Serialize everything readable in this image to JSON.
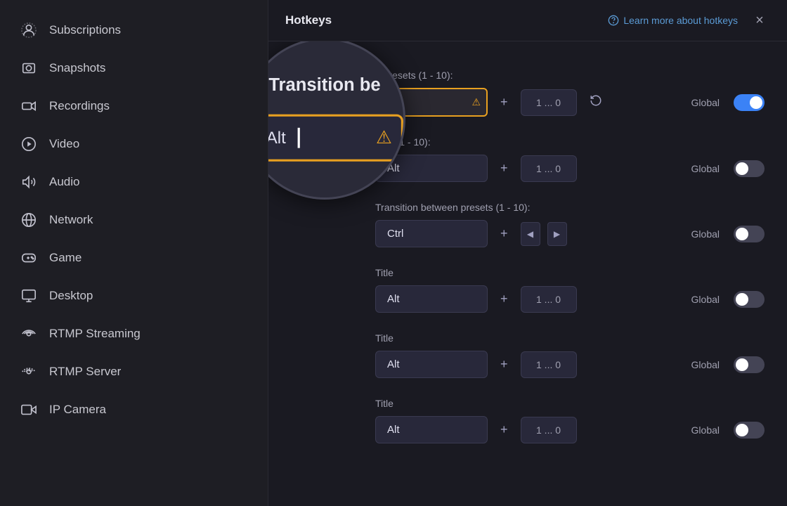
{
  "sidebar": {
    "items": [
      {
        "id": "subscriptions",
        "label": "Subscriptions",
        "icon": "person-circle"
      },
      {
        "id": "snapshots",
        "label": "Snapshots",
        "icon": "image"
      },
      {
        "id": "recordings",
        "label": "Recordings",
        "icon": "video-camera"
      },
      {
        "id": "video",
        "label": "Video",
        "icon": "play-circle"
      },
      {
        "id": "audio",
        "label": "Audio",
        "icon": "speaker"
      },
      {
        "id": "network",
        "label": "Network",
        "icon": "globe"
      },
      {
        "id": "game",
        "label": "Game",
        "icon": "gamepad"
      },
      {
        "id": "desktop",
        "label": "Desktop",
        "icon": "monitor"
      },
      {
        "id": "rtmp-streaming",
        "label": "RTMP Streaming",
        "icon": "broadcast"
      },
      {
        "id": "rtmp-server",
        "label": "RTMP Server",
        "icon": "server"
      },
      {
        "id": "ip-camera",
        "label": "IP Camera",
        "icon": "camera"
      }
    ]
  },
  "header": {
    "title": "Hotkeys",
    "learn_link": "Learn more about hotkeys",
    "close_label": "×"
  },
  "zoom": {
    "title": "Transition be",
    "input_value": "Alt"
  },
  "hotkeys": [
    {
      "label": "n presets (1 - 10):",
      "key": "Alt",
      "key_display": "1 ... 0",
      "global": true,
      "has_warning": true
    },
    {
      "label": "sets (1 - 10):",
      "key": "Alt",
      "key_display": "1 ... 0",
      "global": false,
      "has_warning": false
    },
    {
      "label": "Transition between presets (1 - 10):",
      "key": "Ctrl",
      "key_display": "",
      "has_arrows": true,
      "global": false,
      "has_warning": false
    },
    {
      "label": "Title",
      "key": "Alt",
      "key_display": "1 ... 0",
      "global": false,
      "has_warning": false
    },
    {
      "label": "Title",
      "key": "Alt",
      "key_display": "1 ... 0",
      "global": false,
      "has_warning": false
    },
    {
      "label": "Title",
      "key": "Alt",
      "key_display": "1 ... 0",
      "global": false,
      "has_warning": false
    }
  ]
}
